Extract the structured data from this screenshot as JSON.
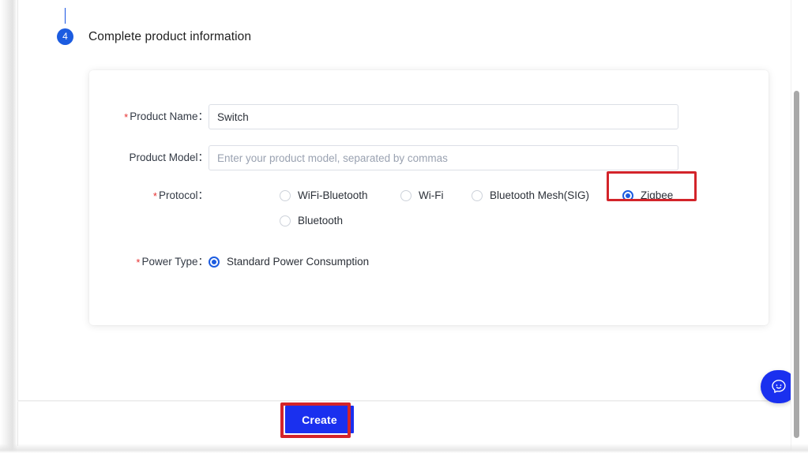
{
  "step": {
    "number": "4",
    "title": "Complete product information"
  },
  "form": {
    "product_name": {
      "label": "Product Name",
      "separator": "：",
      "required": true,
      "value": "Switch",
      "placeholder": ""
    },
    "product_model": {
      "label": "Product Model",
      "separator": "：",
      "required": false,
      "value": "",
      "placeholder": "Enter your product model, separated by commas"
    },
    "protocol": {
      "label": "Protocol",
      "separator": "：",
      "required": true,
      "selected": "Zigbee",
      "options": [
        {
          "label": "WiFi-Bluetooth",
          "checked": false
        },
        {
          "label": "Wi-Fi",
          "checked": false
        },
        {
          "label": "Bluetooth Mesh(SIG)",
          "checked": false
        },
        {
          "label": "Zigbee",
          "checked": true
        },
        {
          "label": "Bluetooth",
          "checked": false
        }
      ]
    },
    "power_type": {
      "label": "Power Type",
      "separator": "：",
      "required": true,
      "selected": "Standard Power Consumption",
      "options": [
        {
          "label": "Standard Power Consumption",
          "checked": true
        }
      ]
    }
  },
  "footer": {
    "create_label": "Create"
  },
  "chat": {
    "icon": "chat-smiley-icon"
  },
  "annotations": [
    {
      "name": "zigbee-highlight",
      "color": "#d3242a",
      "target": "Zigbee"
    },
    {
      "name": "create-highlight",
      "color": "#d3242a",
      "target": "Create"
    }
  ],
  "colors": {
    "accent_blue": "#1c5ce0",
    "button_blue": "#1a30ef",
    "annotation_red": "#d3242a",
    "required_star": "#e63030"
  }
}
